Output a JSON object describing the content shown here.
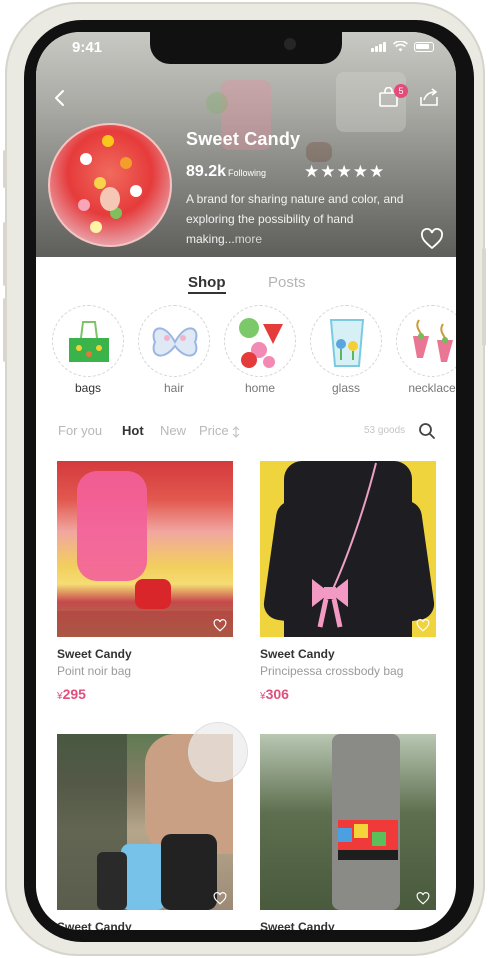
{
  "status_bar": {
    "time": "9:41"
  },
  "header": {
    "brand_name": "Sweet Candy",
    "followers_count": "89.2k",
    "followers_label": "Following",
    "rating_stars": "★★★★★",
    "bio_text": "A brand for sharing nature and color, and exploring the possibility of hand making...",
    "bio_more": "more",
    "cart_count": "5",
    "icons": {
      "back": "back-arrow-icon",
      "cart": "shopping-bag-icon",
      "share": "share-icon",
      "favorite": "heart-icon"
    }
  },
  "tabs": [
    {
      "label": "Shop",
      "active": true
    },
    {
      "label": "Posts",
      "active": false
    }
  ],
  "categories": [
    {
      "label": "bags",
      "active": true
    },
    {
      "label": "hair",
      "active": false
    },
    {
      "label": "home",
      "active": false
    },
    {
      "label": "glass",
      "active": false
    },
    {
      "label": "necklace",
      "active": false
    }
  ],
  "filters": [
    {
      "label": "For you",
      "active": false
    },
    {
      "label": "Hot",
      "active": true
    },
    {
      "label": "New",
      "active": false
    },
    {
      "label": "Price",
      "active": false
    }
  ],
  "goods_count": "53 goods",
  "products": [
    {
      "brand": "Sweet Candy",
      "name": "Point noir bag",
      "currency": "¥",
      "price": "295"
    },
    {
      "brand": "Sweet Candy",
      "name": "Principessa crossbody bag",
      "currency": "¥",
      "price": "306"
    },
    {
      "brand": "Sweet Candy",
      "name": "",
      "currency": "",
      "price": ""
    },
    {
      "brand": "Sweet Candy",
      "name": "",
      "currency": "",
      "price": ""
    }
  ],
  "colors": {
    "accent": "#e14f7d",
    "badge": "#e44a7a",
    "text_primary": "#333333",
    "text_muted": "#9a9a9a"
  }
}
